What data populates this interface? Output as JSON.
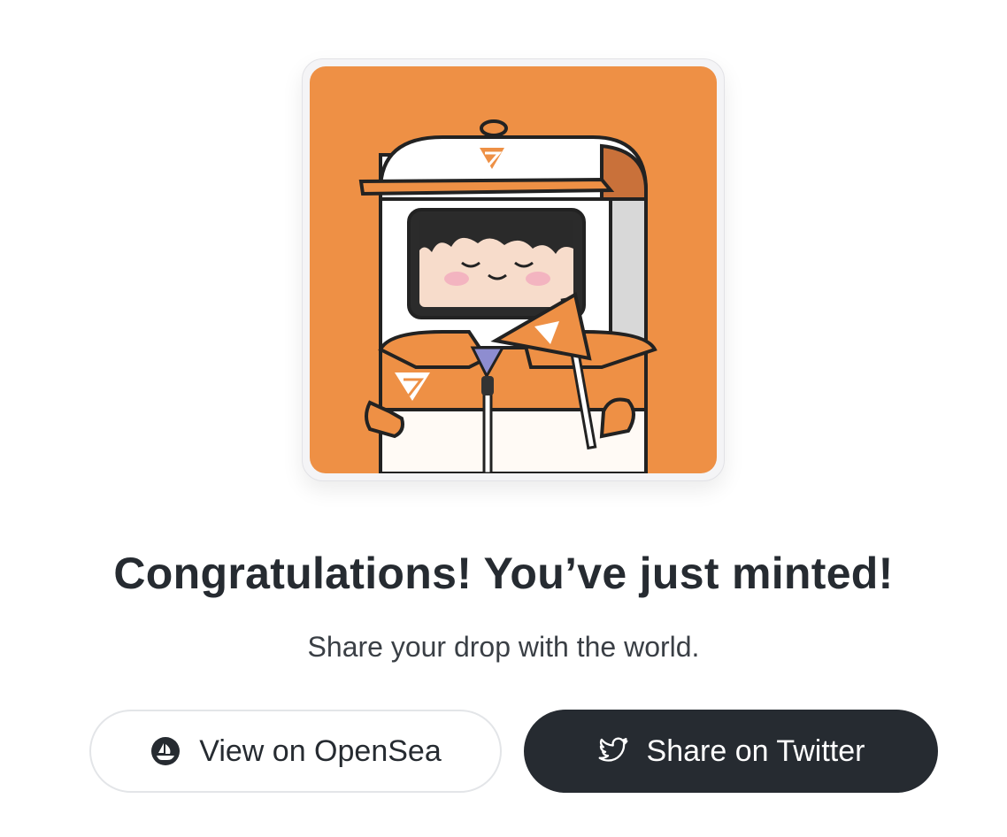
{
  "nft": {
    "image_alt": "Minted NFT character in orange jacket holding a flag"
  },
  "header": {
    "title": "Congratulations! You’ve just minted!",
    "subtitle": "Share your drop with the world."
  },
  "actions": {
    "opensea_label": "View on OpenSea",
    "twitter_label": "Share on Twitter"
  },
  "icons": {
    "opensea": "opensea-icon",
    "twitter": "twitter-bird-icon"
  },
  "colors": {
    "background": "#ffffff",
    "art_background": "#ee9045",
    "text_dark": "#262b31",
    "button_dark": "#262b31",
    "button_border": "#e3e5e8"
  }
}
